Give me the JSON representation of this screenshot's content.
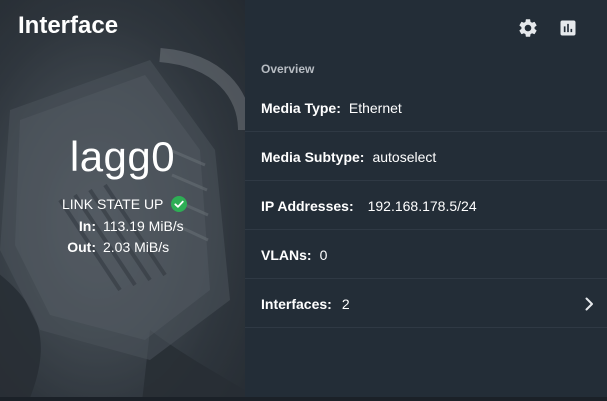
{
  "card": {
    "title": "Interface"
  },
  "interface": {
    "name": "lagg0",
    "link_state": "LINK STATE UP",
    "in_label": "In:",
    "in_value": "113.19 MiB/s",
    "out_label": "Out:",
    "out_value": "2.03 MiB/s"
  },
  "toolbar": {
    "settings_icon": "gear-icon",
    "stats_icon": "bar-chart-icon"
  },
  "overview": {
    "heading": "Overview",
    "rows": [
      {
        "label": "Media Type:",
        "value": "Ethernet"
      },
      {
        "label": "Media Subtype:",
        "value": "autoselect"
      },
      {
        "label": "IP Addresses:",
        "value": "192.168.178.5/24"
      },
      {
        "label": "VLANs:",
        "value": "0"
      },
      {
        "label": "Interfaces:",
        "value": "2"
      }
    ]
  },
  "colors": {
    "accent_green": "#2eae55",
    "panel_bg": "#232d37",
    "text": "#ffffff",
    "heading_muted": "#b7bcc2"
  }
}
